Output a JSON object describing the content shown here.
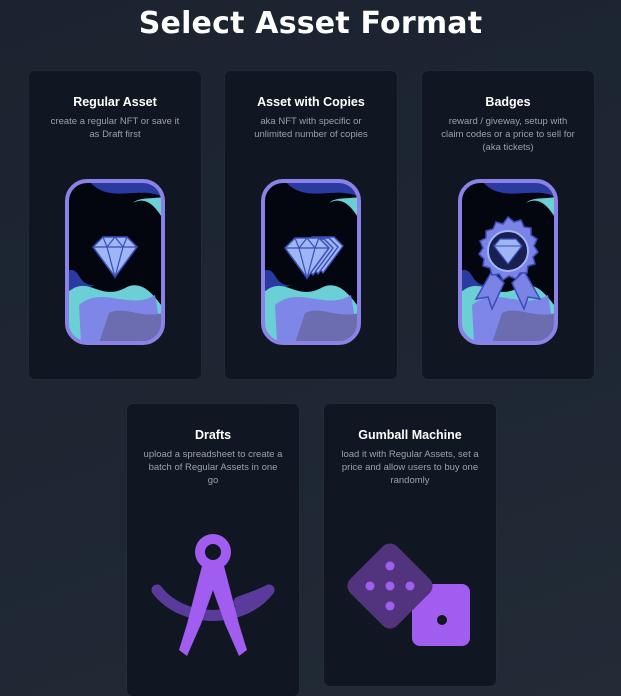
{
  "page": {
    "title": "Select Asset Format"
  },
  "cards": [
    {
      "title": "Regular Asset",
      "description": "create a regular NFT or save it as Draft first",
      "icon": "diamond-card-icon"
    },
    {
      "title": "Asset with Copies",
      "description": "aka NFT with specific or unlimited number of copies",
      "icon": "stacked-diamonds-card-icon"
    },
    {
      "title": "Badges",
      "description": "reward / giveway, setup with claim codes or a price to sell for (aka tickets)",
      "icon": "badge-card-icon"
    },
    {
      "title": "Drafts",
      "description": "upload a spreadsheet to create a batch of Regular Assets in one go",
      "icon": "compass-icon"
    },
    {
      "title": "Gumball Machine",
      "description": "load it with Regular Assets, set a price and allow users to buy one randomly",
      "icon": "dice-icon"
    }
  ],
  "colors": {
    "background": "#1e2733",
    "card": "#111722",
    "accent_purple": "#a15cf0",
    "frame_blue": "#7b83e6",
    "wave_teal": "#74d3d6"
  }
}
